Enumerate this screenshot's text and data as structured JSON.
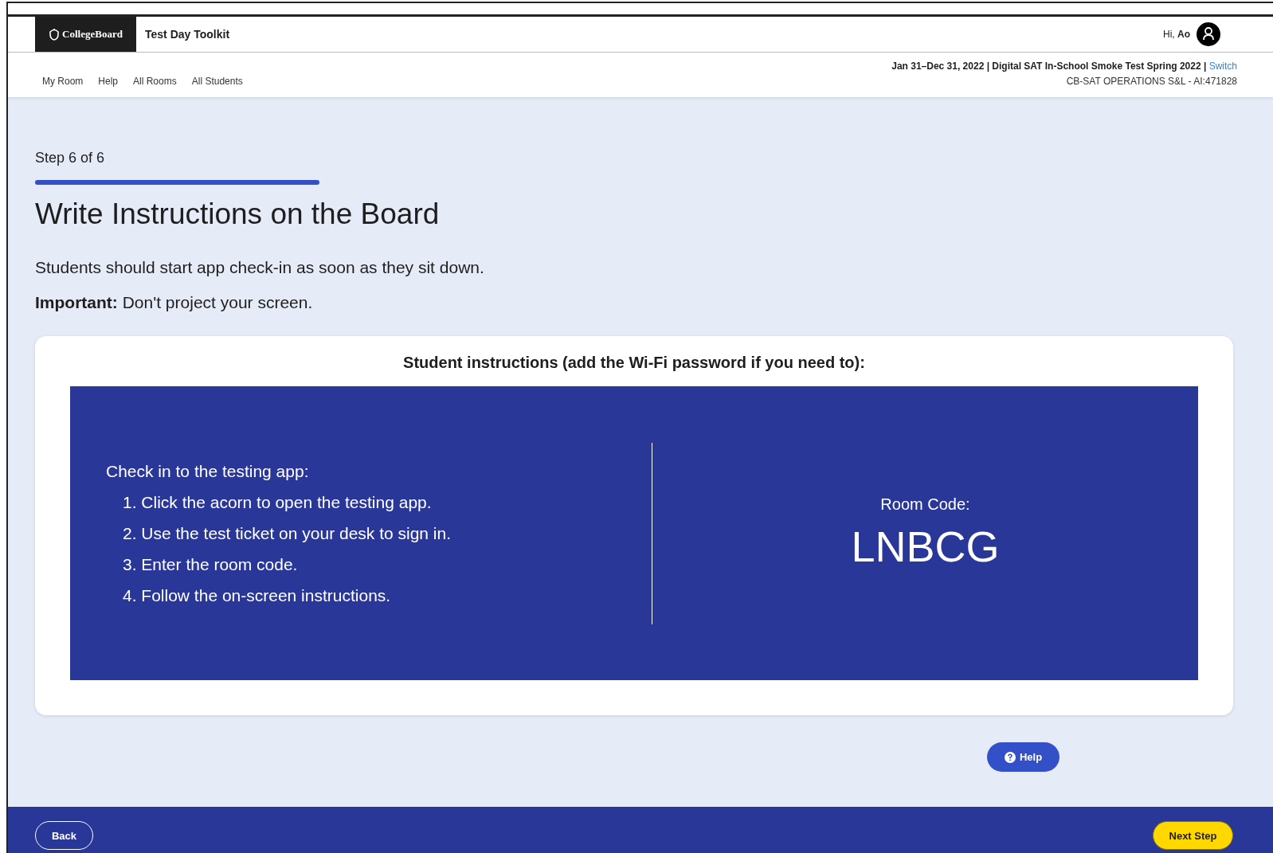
{
  "header": {
    "logo": "CollegeBoard",
    "app_title": "Test Day Toolkit",
    "greeting": "Hi, **Ao**"
  },
  "nav": [
    "My Room",
    "Help",
    "All Rooms",
    "All Students"
  ],
  "event": {
    "summary": "Jan 31–Dec 31, 2022 | Digital SAT In-School Smoke Test Spring 2022 |",
    "switch_link": "Switch",
    "org": "CB-SAT OPERATIONS S&L - AI:471828"
  },
  "step": {
    "label": "Step 6 of 6"
  },
  "title": "Write Instructions on the Board",
  "paragraphs": [
    "Students should start app check-in as soon as they sit down.",
    "**Important:** Don't project your screen."
  ],
  "card": {
    "heading": "Student instructions (add the Wi-Fi password if you need to):",
    "instructions_title": "Check in to the testing app:",
    "steps": [
      "1. Click the acorn to open the testing app.",
      "2. Use the test ticket on your desk to sign in.",
      "3. Enter the room code.",
      "4. Follow the on-screen instructions."
    ],
    "room_code_label": "Room Code:",
    "room_code": "LNBCG"
  },
  "help_button": "Help",
  "footer": {
    "back": "Back",
    "next": "Next Step"
  }
}
